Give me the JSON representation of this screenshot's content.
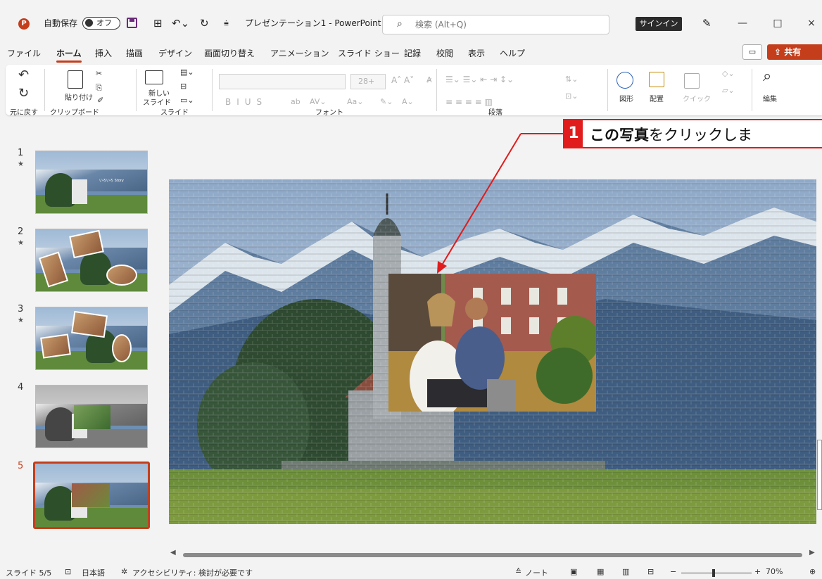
{
  "titlebar": {
    "autosave_label": "自動保存",
    "autosave_state": "オフ",
    "doc_title": "プレゼンテーション1 - PowerPoint",
    "search_placeholder": "検索 (Alt+Q)",
    "signin_label": "サインイン",
    "minimize": "—",
    "maximize": "□",
    "close": "×"
  },
  "menu": {
    "tabs": [
      "ファイル",
      "ホーム",
      "挿入",
      "描画",
      "デザイン",
      "画面切り替え",
      "アニメーション",
      "スライド ショー",
      "記録",
      "校閲",
      "表示",
      "ヘルプ"
    ],
    "active_tab": "ホーム",
    "share_label": "共有"
  },
  "ribbon": {
    "undo_group": "元に戻す",
    "clipboard_group": "クリップボード",
    "paste_label": "貼り付け",
    "slides_group": "スライド",
    "new_slide_label_1": "新しい",
    "new_slide_label_2": "スライド",
    "font_group": "フォント",
    "font_size": "28+",
    "paragraph_group": "段落",
    "shape_label": "図形",
    "arrange_label": "配置",
    "quick_style_label": "クイック",
    "edit_label": "編集"
  },
  "callout": {
    "number": "1",
    "text_bold": "この写真",
    "text_rest": "をクリックしま"
  },
  "slides": [
    {
      "number": "1",
      "star": "★",
      "caption": "いろいろ Story"
    },
    {
      "number": "2",
      "star": "★"
    },
    {
      "number": "3",
      "star": "★"
    },
    {
      "number": "4"
    },
    {
      "number": "5"
    }
  ],
  "statusbar": {
    "slide_pos": "スライド 5/5",
    "language": "日本語",
    "accessibility": "アクセシビリティ: 検討が必要です",
    "notes": "ノート",
    "zoom": "70%"
  },
  "colors": {
    "accent": "#c43e1c",
    "callout_red": "#e01c1c"
  }
}
